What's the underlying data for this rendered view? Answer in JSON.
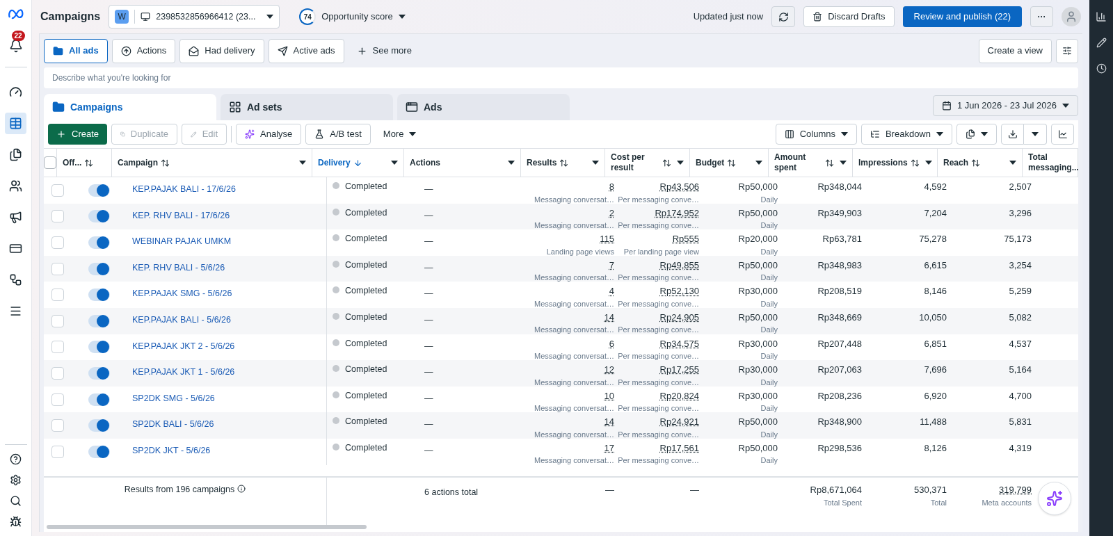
{
  "header": {
    "title": "Campaigns",
    "account_initial": "W",
    "account": "2398532856966412 (23...",
    "score": "74",
    "score_label": "Opportunity score",
    "updated": "Updated just now",
    "discard": "Discard Drafts",
    "publish": "Review and publish (22)",
    "more": "···"
  },
  "notifications": {
    "count": "22"
  },
  "filters": [
    {
      "label": "All ads",
      "selected": true
    },
    {
      "label": "Actions",
      "selected": false
    },
    {
      "label": "Had delivery",
      "selected": false
    },
    {
      "label": "Active ads",
      "selected": false
    }
  ],
  "see_more": "See more",
  "create_view": "Create a view",
  "search": {
    "placeholder": "Describe what you're looking for"
  },
  "tabs": [
    {
      "label": "Campaigns",
      "selected": true
    },
    {
      "label": "Ad sets",
      "selected": false
    },
    {
      "label": "Ads",
      "selected": false
    }
  ],
  "date_range": "1 Jun 2026 - 23 Jul 2026",
  "toolbar": {
    "create": "Create",
    "duplicate": "Duplicate",
    "edit": "Edit",
    "analyse": "Analyse",
    "ab_test": "A/B test",
    "more": "More",
    "columns": "Columns",
    "breakdown": "Breakdown"
  },
  "table": {
    "select_all_checked": false,
    "columns": [
      {
        "label": "Off...",
        "sortable": true,
        "sorted": false,
        "menu": false
      },
      {
        "label": "Campaign",
        "sortable": true,
        "sorted": false,
        "menu": true
      },
      {
        "label": "Delivery",
        "sortable": true,
        "sorted": true,
        "menu": true
      },
      {
        "label": "Actions",
        "sortable": false,
        "sorted": false,
        "menu": true
      },
      {
        "label": "Results",
        "sortable": true,
        "sorted": false,
        "menu": true
      },
      {
        "label": "Cost per result",
        "sortable": true,
        "sorted": false,
        "menu": true
      },
      {
        "label": "Budget",
        "sortable": true,
        "sorted": false,
        "menu": true
      },
      {
        "label": "Amount spent",
        "sortable": true,
        "sorted": false,
        "menu": true
      },
      {
        "label": "Impressions",
        "sortable": true,
        "sorted": false,
        "menu": true
      },
      {
        "label": "Reach",
        "sortable": true,
        "sorted": false,
        "menu": true
      },
      {
        "label": "Total messaging...",
        "sorted": false
      }
    ],
    "rows": [
      {
        "checked": false,
        "on": true,
        "name": "KEP.PAJAK BALI - 17/6/26",
        "delivery": "Completed",
        "actions": "—",
        "results": "8",
        "results_label": "Messaging conversat…",
        "cost": "Rp43,506",
        "cost_label": "Per messaging conve…",
        "budget": "Rp50,000",
        "budget_period": "Daily",
        "amount": "Rp348,044",
        "impressions": "4,592",
        "reach": "2,507"
      },
      {
        "checked": false,
        "on": true,
        "name": "KEP. RHV BALI - 17/6/26",
        "delivery": "Completed",
        "actions": "—",
        "results": "2",
        "results_label": "Messaging conversat…",
        "cost": "Rp174,952",
        "cost_label": "Per messaging conve…",
        "budget": "Rp50,000",
        "budget_period": "Daily",
        "amount": "Rp349,903",
        "impressions": "7,204",
        "reach": "3,296"
      },
      {
        "checked": false,
        "on": true,
        "name": "WEBINAR PAJAK UMKM",
        "delivery": "Completed",
        "actions": "—",
        "results": "115",
        "results_label": "Landing page views",
        "cost": "Rp555",
        "cost_label": "Per landing page view",
        "budget": "Rp20,000",
        "budget_period": "Daily",
        "amount": "Rp63,781",
        "impressions": "75,278",
        "reach": "75,173"
      },
      {
        "checked": false,
        "on": true,
        "name": "KEP. RHV BALI - 5/6/26",
        "delivery": "Completed",
        "actions": "—",
        "results": "7",
        "results_label": "Messaging conversat…",
        "cost": "Rp49,855",
        "cost_label": "Per messaging conve…",
        "budget": "Rp50,000",
        "budget_period": "Daily",
        "amount": "Rp348,983",
        "impressions": "6,615",
        "reach": "3,254"
      },
      {
        "checked": false,
        "on": true,
        "name": "KEP.PAJAK SMG - 5/6/26",
        "delivery": "Completed",
        "actions": "—",
        "results": "4",
        "results_label": "Messaging conversat…",
        "cost": "Rp52,130",
        "cost_label": "Per messaging conve…",
        "budget": "Rp30,000",
        "budget_period": "Daily",
        "amount": "Rp208,519",
        "impressions": "8,146",
        "reach": "5,259"
      },
      {
        "checked": false,
        "on": true,
        "name": "KEP.PAJAK BALI - 5/6/26",
        "delivery": "Completed",
        "actions": "—",
        "results": "14",
        "results_label": "Messaging conversat…",
        "cost": "Rp24,905",
        "cost_label": "Per messaging conve…",
        "budget": "Rp50,000",
        "budget_period": "Daily",
        "amount": "Rp348,669",
        "impressions": "10,050",
        "reach": "5,082"
      },
      {
        "checked": false,
        "on": true,
        "name": "KEP.PAJAK JKT 2 - 5/6/26",
        "delivery": "Completed",
        "actions": "—",
        "results": "6",
        "results_label": "Messaging conversat…",
        "cost": "Rp34,575",
        "cost_label": "Per messaging conve…",
        "budget": "Rp30,000",
        "budget_period": "Daily",
        "amount": "Rp207,448",
        "impressions": "6,851",
        "reach": "4,537"
      },
      {
        "checked": false,
        "on": true,
        "name": "KEP.PAJAK JKT 1 - 5/6/26",
        "delivery": "Completed",
        "actions": "—",
        "results": "12",
        "results_label": "Messaging conversat…",
        "cost": "Rp17,255",
        "cost_label": "Per messaging conve…",
        "budget": "Rp30,000",
        "budget_period": "Daily",
        "amount": "Rp207,063",
        "impressions": "7,696",
        "reach": "5,164"
      },
      {
        "checked": false,
        "on": true,
        "name": "SP2DK SMG - 5/6/26",
        "delivery": "Completed",
        "actions": "—",
        "results": "10",
        "results_label": "Messaging conversat…",
        "cost": "Rp20,824",
        "cost_label": "Per messaging conve…",
        "budget": "Rp30,000",
        "budget_period": "Daily",
        "amount": "Rp208,236",
        "impressions": "6,920",
        "reach": "4,700"
      },
      {
        "checked": false,
        "on": true,
        "name": "SP2DK BALI - 5/6/26",
        "delivery": "Completed",
        "actions": "—",
        "results": "14",
        "results_label": "Messaging conversat…",
        "cost": "Rp24,921",
        "cost_label": "Per messaging conve…",
        "budget": "Rp50,000",
        "budget_period": "Daily",
        "amount": "Rp348,900",
        "impressions": "11,488",
        "reach": "5,831"
      },
      {
        "checked": false,
        "on": true,
        "name": "SP2DK JKT - 5/6/26",
        "delivery": "Completed",
        "actions": "—",
        "results": "17",
        "results_label": "Messaging conversat…",
        "cost": "Rp17,561",
        "cost_label": "Per messaging conve…",
        "budget": "Rp50,000",
        "budget_period": "Daily",
        "amount": "Rp298,536",
        "impressions": "8,126",
        "reach": "4,319"
      }
    ],
    "footer": {
      "summary": "Results from 196 campaigns",
      "actions": "6 actions total",
      "results": "—",
      "cost": "—",
      "amount": "Rp8,671,064",
      "amount_label": "Total Spent",
      "impressions": "530,371",
      "impressions_label": "Total",
      "reach": "319,799",
      "reach_label": "Meta accounts"
    }
  }
}
